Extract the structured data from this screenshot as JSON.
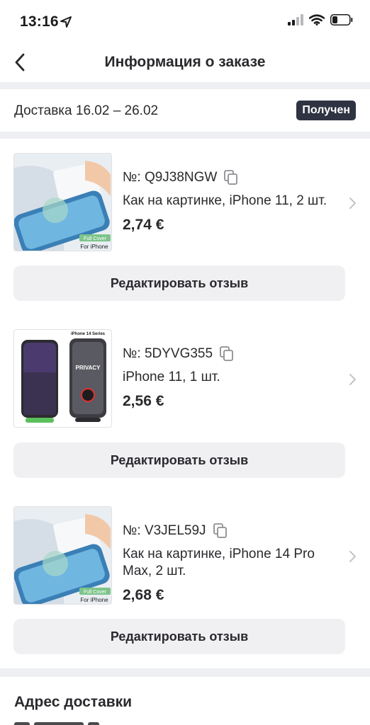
{
  "status_bar": {
    "time": "13:16",
    "location_icon": "location-arrow-icon",
    "signal_icon": "cellular-signal-icon",
    "wifi_icon": "wifi-icon",
    "battery_icon": "battery-icon"
  },
  "nav": {
    "back_icon": "chevron-left-icon",
    "title": "Информация о заказе"
  },
  "delivery": {
    "text": "Доставка 16.02 – 26.02",
    "status": "Получен",
    "status_color": "#2f3342"
  },
  "products": [
    {
      "order_number": "№: Q9J38NGW",
      "variant": "Как на картинке, iPhone 11, 2 шт.",
      "price": "2,74 €",
      "image_caption_1": "Full Cover",
      "image_caption_2": "For iPhone",
      "review_button": "Редактировать отзыв"
    },
    {
      "order_number": "№: 5DYVG355",
      "variant": "iPhone 11, 1 шт.",
      "price": "2,56 €",
      "image_caption_1": "iPhone 14 Series",
      "image_caption_2": "PRIVACY",
      "review_button": "Редактировать отзыв"
    },
    {
      "order_number": "№: V3JEL59J",
      "variant": "Как на картинке, iPhone 14 Pro Max, 2 шт.",
      "price": "2,68 €",
      "image_caption_1": "Full Cover",
      "image_caption_2": "For iPhone",
      "review_button": "Редактировать отзыв"
    }
  ],
  "address": {
    "title": "Адрес доставки"
  },
  "colors": {
    "separator": "#eeeff2",
    "button_bg": "#f0f0f3",
    "text": "#2a2a2e"
  }
}
